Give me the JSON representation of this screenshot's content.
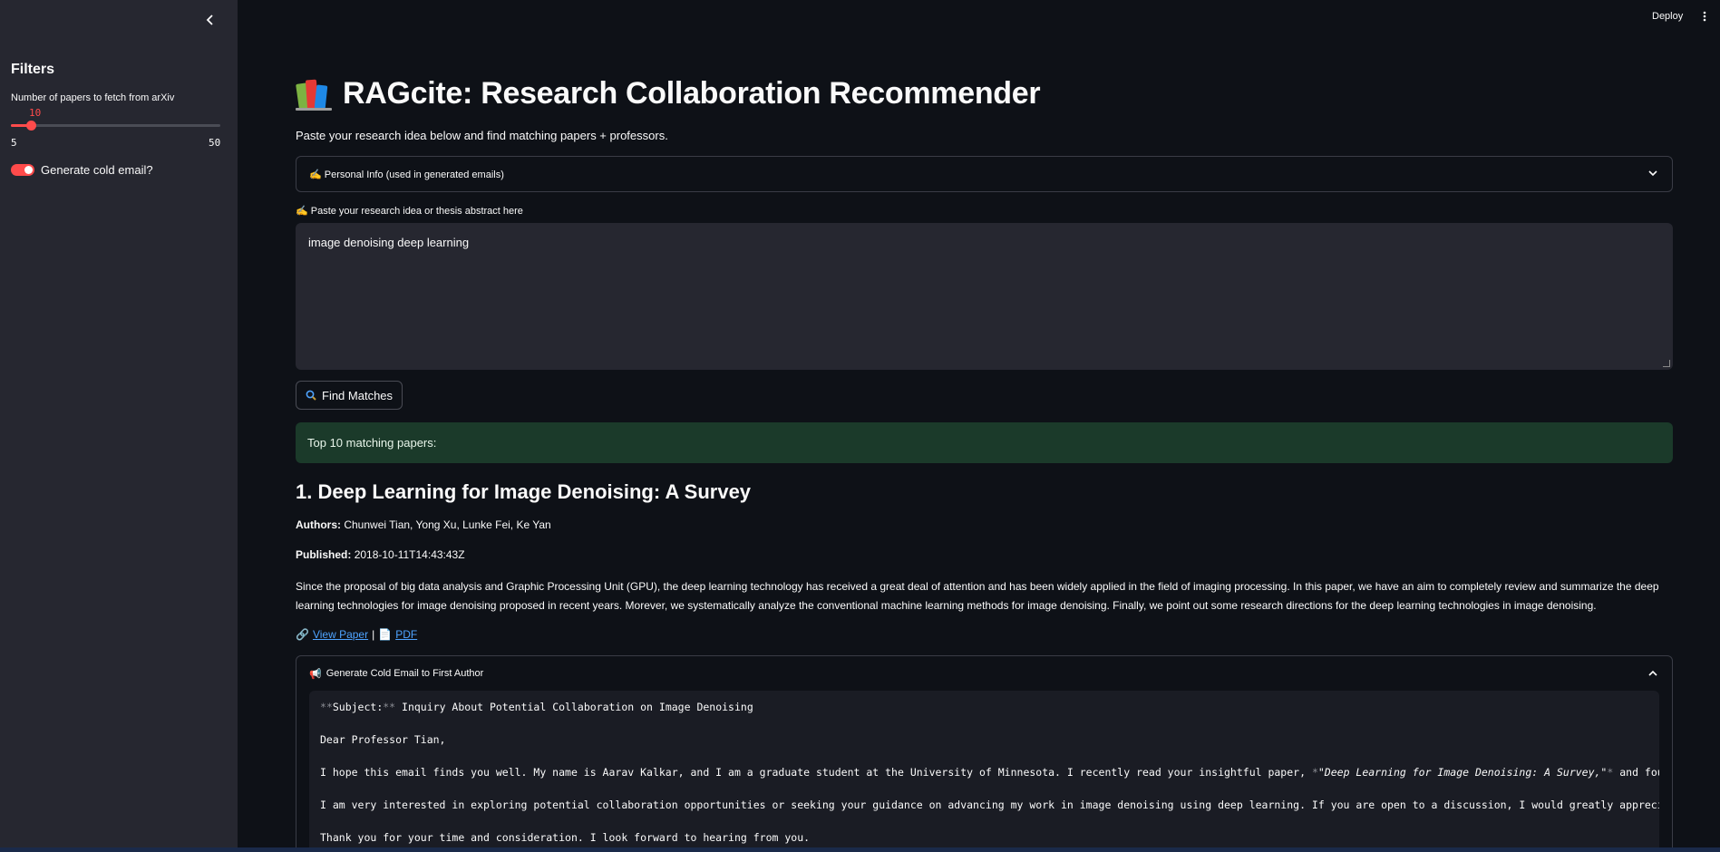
{
  "sidebar": {
    "title": "Filters",
    "slider": {
      "label": "Number of papers to fetch from arXiv",
      "value": "10",
      "min": "5",
      "max": "50",
      "fraction": 0.111
    },
    "toggle": {
      "label": "Generate cold email?",
      "on": true
    }
  },
  "header": {
    "deploy": "Deploy"
  },
  "main": {
    "title": "RAGcite: Research Collaboration Recommender",
    "intro": "Paste your research idea below and find matching papers + professors.",
    "personal_info": "✍️ Personal Info (used in generated emails)",
    "textarea_label": "✍️ Paste your research idea or thesis abstract here",
    "textarea_value": "image denoising deep learning",
    "find_button": "Find Matches",
    "success": "Top 10 matching papers:",
    "paper": {
      "title": "1. Deep Learning for Image Denoising: A Survey",
      "authors_label": "Authors:",
      "authors": "Chunwei Tian, Yong Xu, Lunke Fei, Ke Yan",
      "published_label": "Published:",
      "published": "2018-10-11T14:43:43Z",
      "abstract": "Since the proposal of big data analysis and Graphic Processing Unit (GPU), the deep learning technology has received a great deal of attention and has been widely applied in the field of imaging processing. In this paper, we have an aim to completely review and summarize the deep learning technologies for image denoising proposed in recent years. Morever, we systematically analyze the conventional machine learning methods for image denoising. Finally, we point out some research directions for the deep learning technologies in image denoising.",
      "view_paper": "View Paper",
      "separator": "|",
      "pdf": "PDF"
    },
    "email": {
      "header": "Generate Cold Email to First Author",
      "subject_marker_open": "**",
      "subject_label": "Subject:",
      "subject_marker_close": "**",
      "subject": " Inquiry About Potential Collaboration on Image Denoising",
      "greeting": "Dear Professor Tian,",
      "line1_a": "I hope this email finds you well. My name is Aarav Kalkar, and I am a graduate student at the University of Minnesota. I recently read your insightful paper, ",
      "line1_marker": "*",
      "line1_title": "\"Deep Learning for Image Denoising: A Survey,\"",
      "line1_b": " and found it",
      "line2": "I am very interested in exploring potential collaboration opportunities or seeking your guidance on advancing my work in image denoising using deep learning. If you are open to a discussion, I would greatly appreciate th",
      "line3": "Thank you for your time and consideration. I look forward to hearing from you."
    }
  },
  "colors": {
    "accent": "#ff4b4b",
    "link": "#4ea3ff",
    "success_bg": "#1b3a2a",
    "sidebar_bg": "#262730",
    "page_bg": "#0e1117"
  }
}
